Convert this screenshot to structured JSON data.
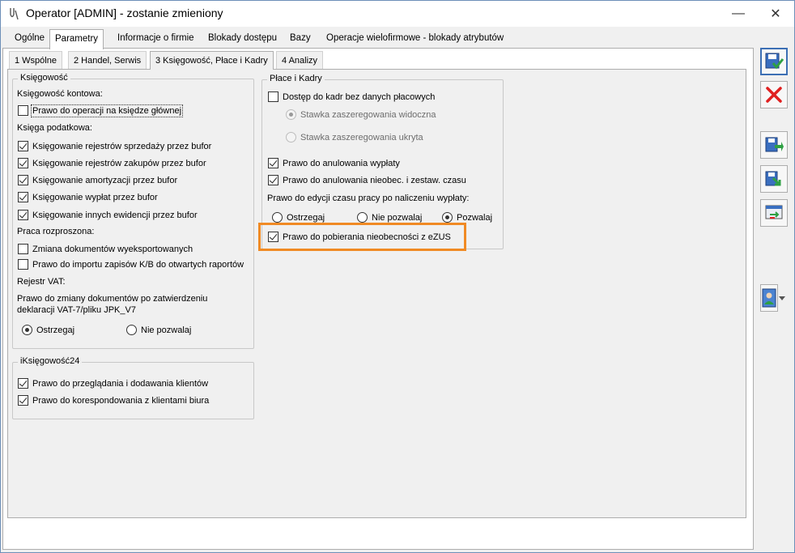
{
  "window": {
    "title": "Operator [ADMIN] - zostanie zmieniony",
    "minimize_glyph": "—",
    "close_glyph": "✕"
  },
  "tabs": [
    {
      "label": "Ogólne"
    },
    {
      "label": "Parametry"
    },
    {
      "label": "Informacje o firmie"
    },
    {
      "label": "Blokady dostępu"
    },
    {
      "label": "Bazy"
    },
    {
      "label": "Operacje wielofirmowe - blokady atrybutów"
    }
  ],
  "subtabs": [
    {
      "label": "1 Wspólne"
    },
    {
      "label": "2 Handel, Serwis"
    },
    {
      "label": "3 Księgowość, Płace i Kadry"
    },
    {
      "label": "4 Analizy"
    }
  ],
  "ksiegowosc": {
    "title": "Księgowość",
    "kontowa_label": "Księgowość kontowa:",
    "prawo_operacji": {
      "label": "Prawo do operacji na księdze głównej",
      "checked": false
    },
    "podatkowa_label": "Księga podatkowa:",
    "podatkowa_items": [
      {
        "label": "Księgowanie rejestrów sprzedaży przez bufor",
        "checked": true
      },
      {
        "label": "Księgowanie rejestrów zakupów przez bufor",
        "checked": true
      },
      {
        "label": "Księgowanie amortyzacji przez bufor",
        "checked": true
      },
      {
        "label": "Księgowanie wypłat przez bufor",
        "checked": true
      },
      {
        "label": "Księgowanie innych ewidencji przez bufor",
        "checked": true
      }
    ],
    "rozproszona_label": "Praca rozproszona:",
    "rozproszona_items": [
      {
        "label": "Zmiana dokumentów wyeksportowanych",
        "checked": false
      },
      {
        "label": "Prawo do importu zapisów K/B do otwartych raportów",
        "checked": false
      }
    ],
    "rejestr_label": "Rejestr VAT:",
    "vat_text_line1": "Prawo do zmiany dokumentów po zatwierdzeniu",
    "vat_text_line2": "deklaracji VAT-7/pliku JPK_V7",
    "vat_options": [
      {
        "label": "Ostrzegaj",
        "selected": true
      },
      {
        "label": "Nie pozwalaj",
        "selected": false
      }
    ]
  },
  "iksiegowosc": {
    "title": "iKsięgowość24",
    "items": [
      {
        "label": "Prawo do przeglądania i dodawania klientów",
        "checked": true
      },
      {
        "label": "Prawo do korespondowania z klientami biura",
        "checked": true
      }
    ]
  },
  "place": {
    "title": "Płace i Kadry",
    "dostep": {
      "label": "Dostęp do kadr bez danych płacowych",
      "checked": false
    },
    "stawka_widoczna": {
      "label": "Stawka zaszeregowania widoczna",
      "selected": true
    },
    "stawka_ukryta": {
      "label": "Stawka zaszeregowania ukryta",
      "selected": false
    },
    "anulowania_wyplaty": {
      "label": "Prawo do anulowania wypłaty",
      "checked": true
    },
    "anulowania_nieobec": {
      "label": "Prawo do anulowania nieobec. i zestaw. czasu",
      "checked": true
    },
    "edycja_label": "Prawo do edycji czasu pracy po naliczeniu wypłaty:",
    "edycja_options": [
      {
        "label": "Ostrzegaj",
        "selected": false
      },
      {
        "label": "Nie pozwalaj",
        "selected": false
      },
      {
        "label": "Pozwalaj",
        "selected": true
      }
    ],
    "ezus": {
      "label": "Prawo do pobierania nieobecności z eZUS",
      "checked": true
    }
  },
  "highlight_color": "#f08a24",
  "sidebar_icons": [
    "save-icon",
    "cancel-icon",
    "save-and-new-icon",
    "save-and-copy-icon",
    "change-icon",
    "operator-card-icon"
  ]
}
